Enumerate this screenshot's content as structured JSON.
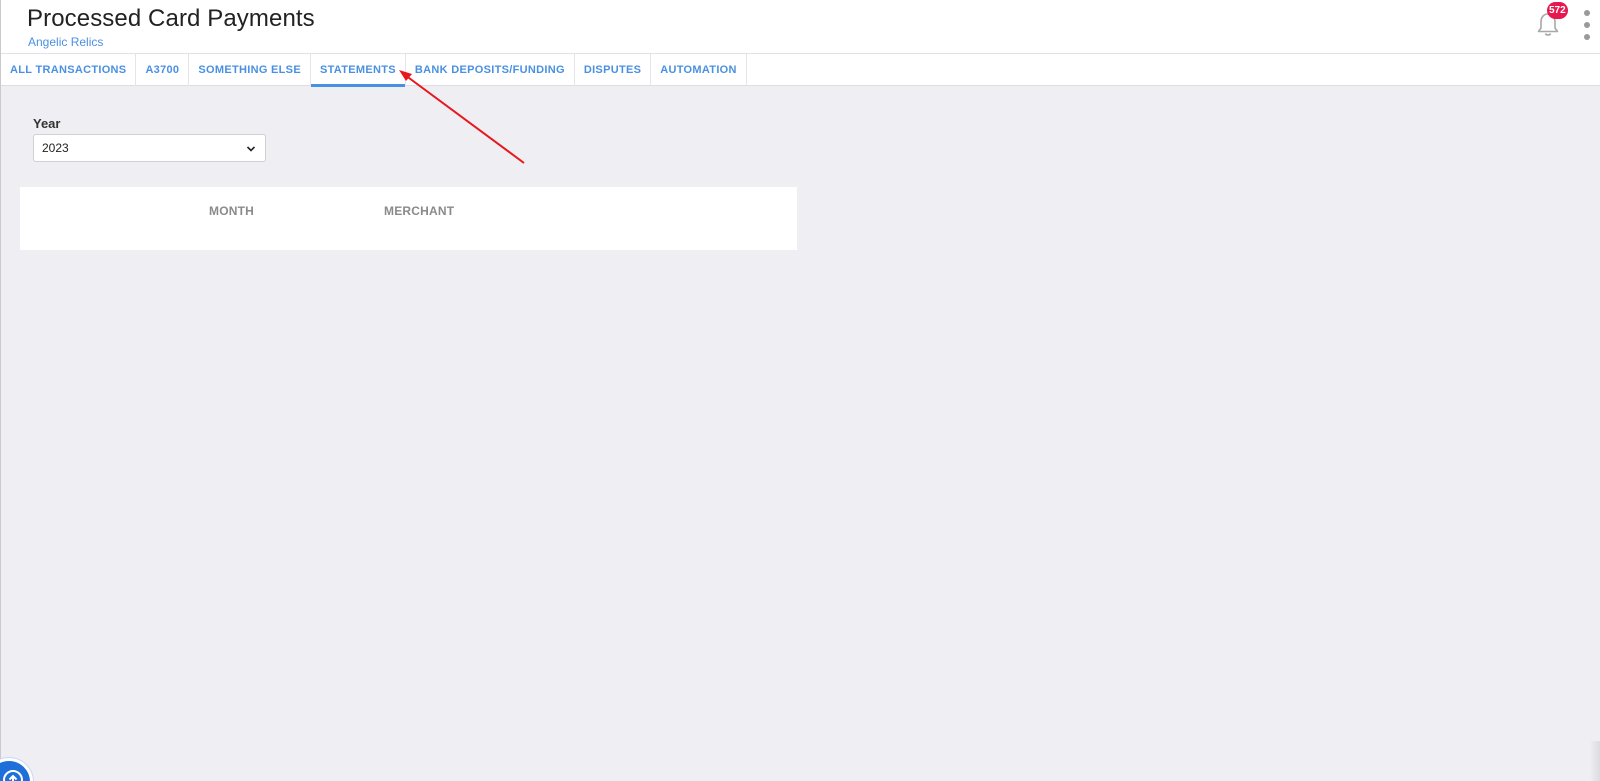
{
  "header": {
    "title": "Processed Card Payments",
    "subtitle": "Angelic Relics",
    "notification_count": "572"
  },
  "tabs": [
    {
      "label": "ALL TRANSACTIONS",
      "active": false
    },
    {
      "label": "A3700",
      "active": false
    },
    {
      "label": "SOMETHING ELSE",
      "active": false
    },
    {
      "label": "STATEMENTS",
      "active": true
    },
    {
      "label": "BANK DEPOSITS/FUNDING",
      "active": false
    },
    {
      "label": "DISPUTES",
      "active": false
    },
    {
      "label": "AUTOMATION",
      "active": false
    }
  ],
  "filter": {
    "year_label": "Year",
    "year_value": "2023"
  },
  "table": {
    "columns": [
      "MONTH",
      "MERCHANT"
    ]
  },
  "icons": {
    "notification": "bell-icon",
    "more": "more-vertical-icon",
    "select": "chevron-down-icon",
    "helper": "help-widget-icon"
  },
  "colors": {
    "accent": "#4a90e2",
    "badge": "#e5194f",
    "annotation": "#e8161d",
    "background": "#efeef3"
  }
}
